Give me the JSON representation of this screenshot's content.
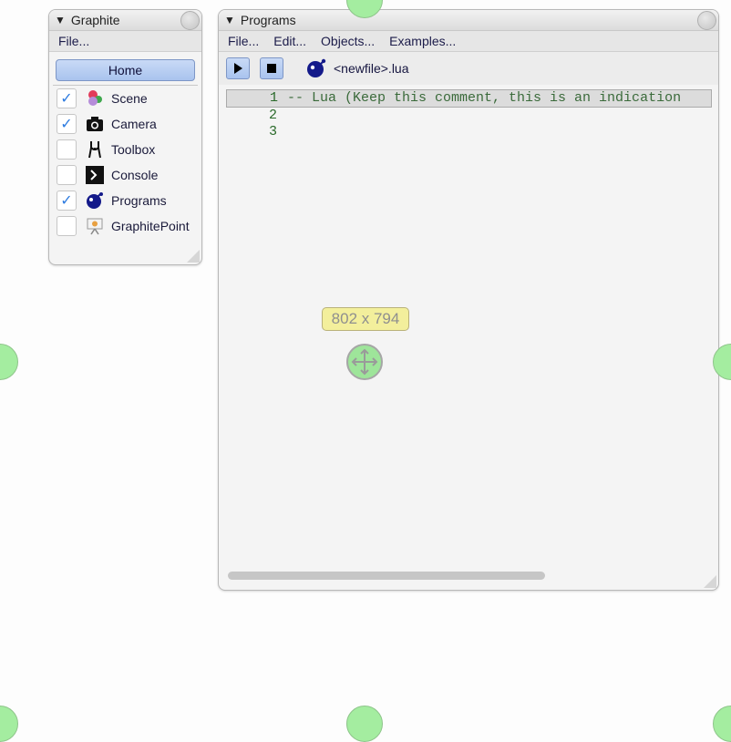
{
  "graphite": {
    "title": "Graphite",
    "menu": [
      "File..."
    ],
    "home_label": "Home",
    "items": [
      {
        "label": "Scene",
        "checked": true,
        "icon": "scene-icon"
      },
      {
        "label": "Camera",
        "checked": true,
        "icon": "camera-icon"
      },
      {
        "label": "Toolbox",
        "checked": false,
        "icon": "toolbox-icon"
      },
      {
        "label": "Console",
        "checked": false,
        "icon": "console-icon"
      },
      {
        "label": "Programs",
        "checked": true,
        "icon": "programs-icon"
      },
      {
        "label": "GraphitePoint",
        "checked": false,
        "icon": "presentation-icon"
      }
    ]
  },
  "programs": {
    "title": "Programs",
    "menu": [
      "File...",
      "Edit...",
      "Objects...",
      "Examples..."
    ],
    "filename": "<newfile>.lua",
    "lines": [
      {
        "num": "1",
        "text": "-- Lua (Keep this comment, this is an indication"
      },
      {
        "num": "2",
        "text": ""
      },
      {
        "num": "3",
        "text": ""
      }
    ]
  },
  "size_tooltip": "802 x 794",
  "check_mark": "✓",
  "colors": {
    "accent": "#2d7be0",
    "handle": "#a4eda0",
    "tooltip": "#f3ef9c"
  }
}
